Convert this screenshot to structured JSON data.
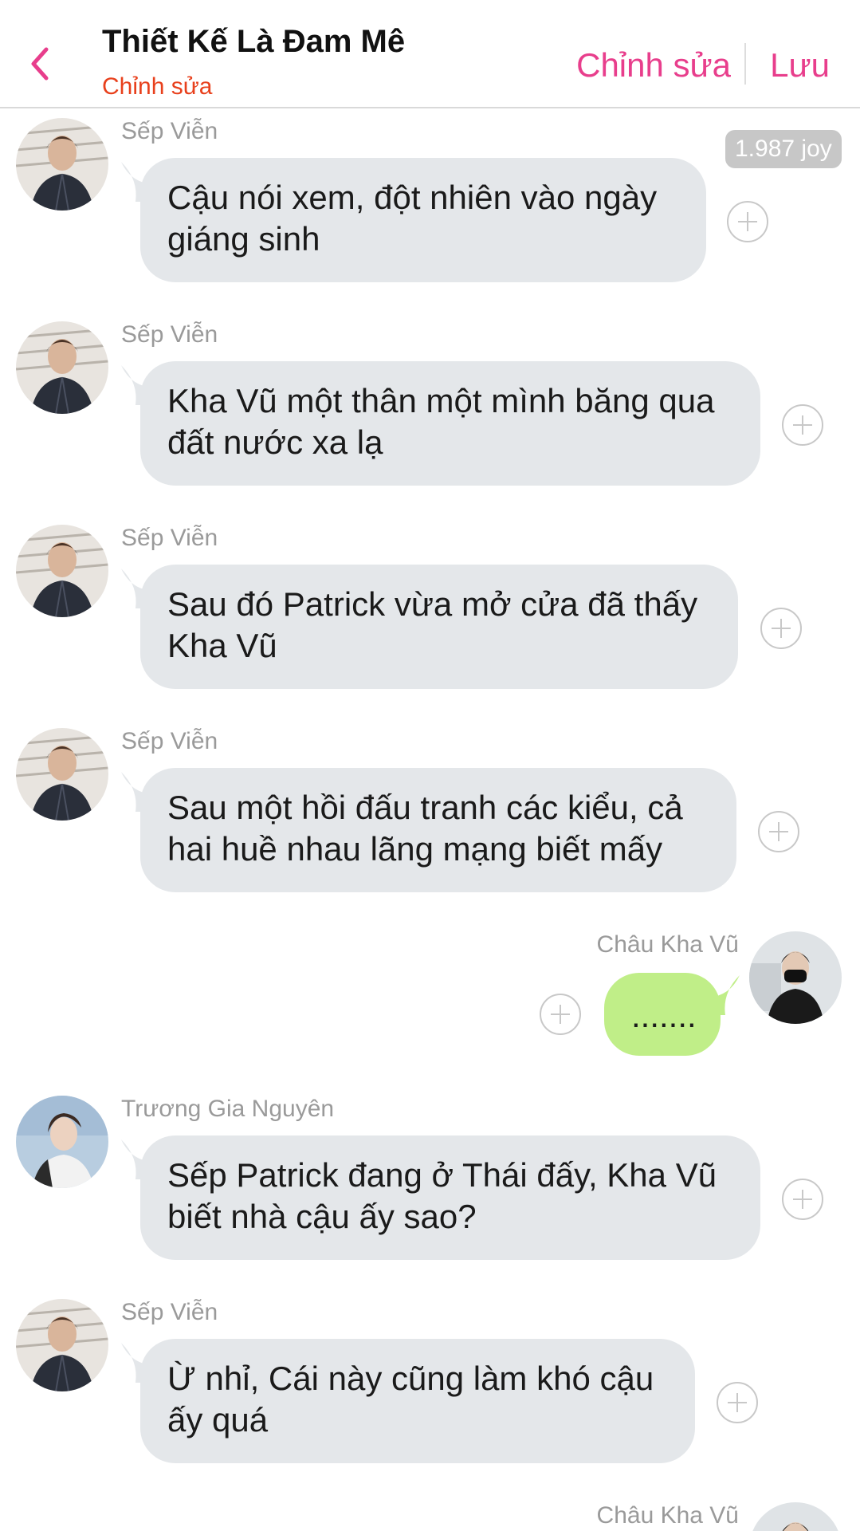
{
  "header": {
    "title": "Thiết Kế Là Đam Mê",
    "subtitle": "Chỉnh sửa",
    "edit_label": "Chỉnh sửa",
    "save_label": "Lưu"
  },
  "badge": {
    "joy": "1.987 joy"
  },
  "colors": {
    "accent": "#e83e8c",
    "subtitle": "#e8401c",
    "incoming_bubble": "#e4e7ea",
    "outgoing_bubble": "#c0ee88"
  },
  "messages": [
    {
      "sender": "Sếp Viễn",
      "side": "left",
      "lines": [
        "Cậu nói xem, đột nhiên vào ngày",
        "giáng sinh"
      ]
    },
    {
      "sender": "Sếp Viễn",
      "side": "left",
      "lines": [
        "Kha Vũ một thân một mình băng qua",
        "đất nước xa lạ"
      ]
    },
    {
      "sender": "Sếp Viễn",
      "side": "left",
      "lines": [
        "Sau đó Patrick vừa mở cửa đã thấy",
        "Kha Vũ"
      ]
    },
    {
      "sender": "Sếp Viễn",
      "side": "left",
      "lines": [
        "Sau một hồi đấu tranh các kiểu, cả",
        "hai huề nhau lãng mạng biết mấy"
      ]
    },
    {
      "sender": "Châu Kha Vũ",
      "side": "right",
      "lines": [
        "......."
      ]
    },
    {
      "sender": "Trương Gia Nguyên",
      "side": "left",
      "lines": [
        "Sếp Patrick đang ở Thái đấy, Kha Vũ",
        "biết nhà cậu ấy sao?"
      ]
    },
    {
      "sender": "Sếp Viễn",
      "side": "left",
      "lines": [
        "Ừ nhỉ, Cái này cũng làm khó cậu",
        "ấy quá"
      ]
    },
    {
      "sender": "Châu Kha Vũ",
      "side": "right",
      "lines": []
    }
  ]
}
